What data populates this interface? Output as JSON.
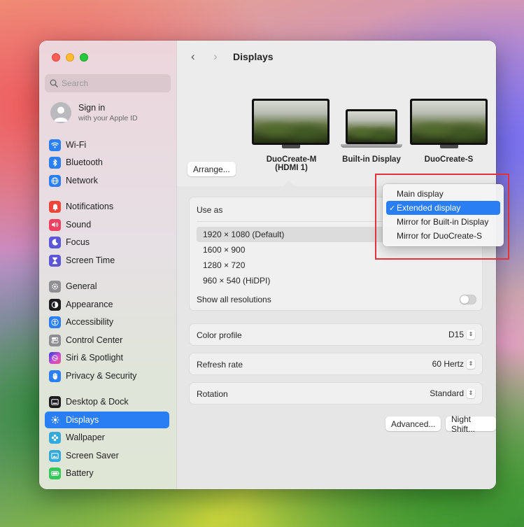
{
  "window": {
    "title": "Displays"
  },
  "sidebar": {
    "search_placeholder": "Search",
    "account": {
      "line1": "Sign in",
      "line2": "with your Apple ID"
    },
    "items": [
      {
        "label": "Wi-Fi",
        "icon": "wifi-icon",
        "color": "#2b7ff5"
      },
      {
        "label": "Bluetooth",
        "icon": "bluetooth-icon",
        "color": "#2b7ff5"
      },
      {
        "label": "Network",
        "icon": "globe-icon",
        "color": "#2b7ff5"
      },
      {
        "label": "Notifications",
        "icon": "bell-icon",
        "color": "#f0463a"
      },
      {
        "label": "Sound",
        "icon": "speaker-icon",
        "color": "#f04060"
      },
      {
        "label": "Focus",
        "icon": "moon-icon",
        "color": "#5d56d6"
      },
      {
        "label": "Screen Time",
        "icon": "hourglass-icon",
        "color": "#5d56d6"
      },
      {
        "label": "General",
        "icon": "gear-icon",
        "color": "#8e8e93"
      },
      {
        "label": "Appearance",
        "icon": "appearance-icon",
        "color": "#1c1c1e"
      },
      {
        "label": "Accessibility",
        "icon": "accessibility-icon",
        "color": "#2b7ff5"
      },
      {
        "label": "Control Center",
        "icon": "control-center-icon",
        "color": "#8e8e93"
      },
      {
        "label": "Siri & Spotlight",
        "icon": "siri-icon",
        "color": "#b04ad8"
      },
      {
        "label": "Privacy & Security",
        "icon": "hand-icon",
        "color": "#2b7ff5"
      },
      {
        "label": "Desktop & Dock",
        "icon": "dock-icon",
        "color": "#1c1c1e"
      },
      {
        "label": "Displays",
        "icon": "sun-icon",
        "color": "#2b7ff5",
        "selected": true
      },
      {
        "label": "Wallpaper",
        "icon": "flower-icon",
        "color": "#34aadc"
      },
      {
        "label": "Screen Saver",
        "icon": "screen-saver-icon",
        "color": "#34aadc"
      },
      {
        "label": "Battery",
        "icon": "battery-icon",
        "color": "#34c759"
      }
    ]
  },
  "displays": {
    "arrange_button": "Arrange...",
    "monitors": [
      {
        "name": "DuoCreate-M",
        "sub": "(HDMI 1)"
      },
      {
        "name": "Built-in Display",
        "sub": ""
      },
      {
        "name": "DuoCreate-S",
        "sub": ""
      }
    ]
  },
  "settings": {
    "use_as_label": "Use as",
    "resolutions": [
      "1920 × 1080 (Default)",
      "1600 × 900",
      "1280 × 720",
      "960 × 540 (HiDPI)"
    ],
    "selected_resolution": "1920 × 1080 (Default)",
    "show_all_label": "Show all resolutions",
    "show_all_enabled": false,
    "color_profile_label": "Color profile",
    "color_profile_value": "D15",
    "refresh_rate_label": "Refresh rate",
    "refresh_rate_value": "60 Hertz",
    "rotation_label": "Rotation",
    "rotation_value": "Standard",
    "advanced_button": "Advanced...",
    "night_shift_button": "Night Shift...",
    "help_button": "?"
  },
  "use_as_menu": {
    "options": [
      "Main display",
      "Extended display",
      "Mirror for Built-in Display",
      "Mirror for DuoCreate-S"
    ],
    "checked": "Extended display",
    "check_mark": "✓"
  },
  "colors": {
    "accent": "#2a7ef4",
    "annotation": "#e0333a"
  }
}
